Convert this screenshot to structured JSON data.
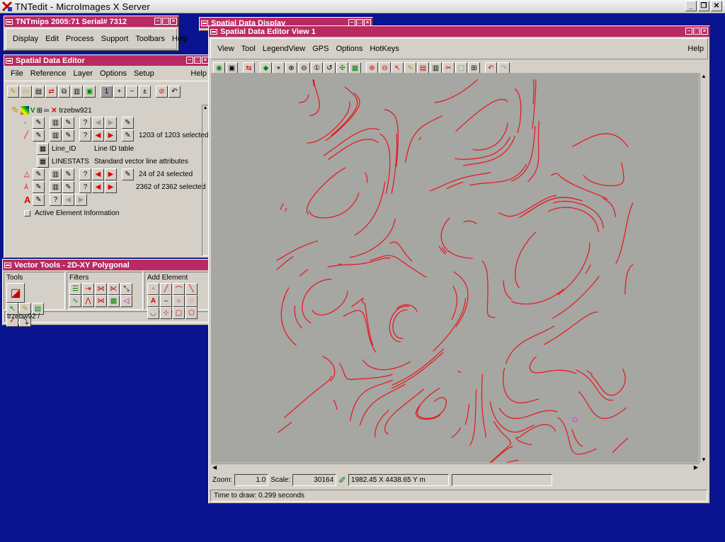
{
  "xserver": {
    "title": "TNTedit - MicroImages X Server"
  },
  "main": {
    "title": "TNTmips 2005:71  Serial# 7312",
    "menu": [
      "Display",
      "Edit",
      "Process",
      "Support",
      "Toolbars",
      "Help"
    ]
  },
  "spatial_display": {
    "title": "Spatial Data Display"
  },
  "editor": {
    "title": "Spatial Data Editor",
    "menu": [
      "File",
      "Reference",
      "Layer",
      "Options",
      "Setup",
      "Help"
    ],
    "layer_name": "trzebw921",
    "rows": [
      {
        "status": ""
      },
      {
        "status": "1203 of 1203 selected"
      },
      {
        "name": "Line_ID",
        "desc": "Line ID table"
      },
      {
        "name": "LINESTATS",
        "desc": "Standard vector line attributes"
      },
      {
        "status": "24 of 24 selected"
      },
      {
        "status": "2362 of 2362 selected"
      }
    ],
    "active_info": "Active Element Information"
  },
  "vtools": {
    "title": "Vector Tools - 2D-XY Polygonal",
    "groups": [
      "Tools",
      "Filters",
      "Add Element"
    ],
    "status": "trzebw92 /"
  },
  "view": {
    "title": "Spatial Data Editor View 1",
    "menu": [
      "View",
      "Tool",
      "LegendView",
      "GPS",
      "Options",
      "HotKeys",
      "Help"
    ],
    "zoom_label": "Zoom:",
    "zoom": "1.0",
    "scale_label": "Scale:",
    "scale": "30164",
    "coords": "1982.45 X 4438.65 Y m",
    "draw_time": "Time to draw: 0.299 seconds"
  },
  "colors": {
    "title_bar": "#b92a63",
    "desktop": "#0a1490",
    "contour": "#e8141c"
  }
}
